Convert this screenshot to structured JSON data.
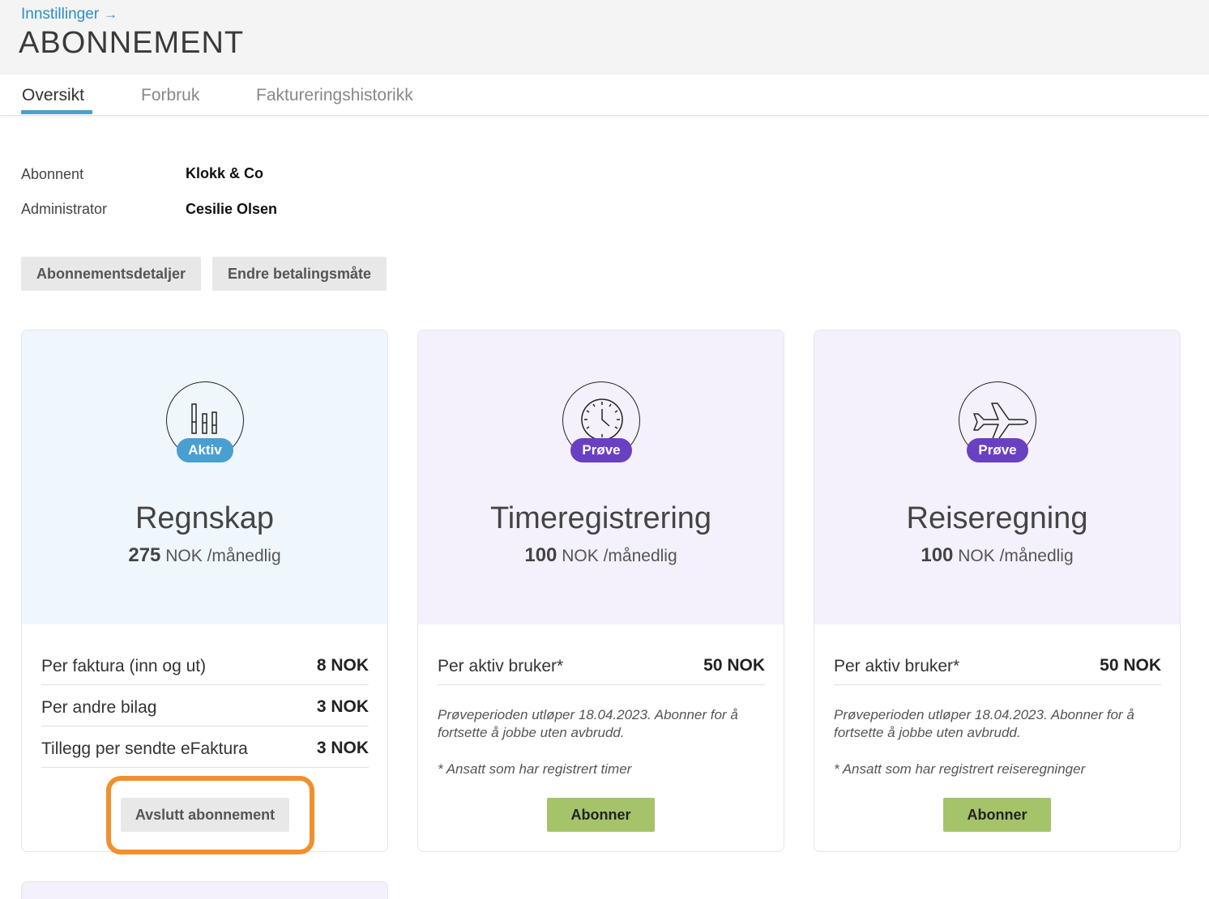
{
  "header": {
    "breadcrumb": "Innstillinger",
    "breadcrumb_arrow": "→",
    "title": "ABONNEMENT"
  },
  "tabs": [
    {
      "label": "Oversikt",
      "active": true
    },
    {
      "label": "Forbruk",
      "active": false
    },
    {
      "label": "Faktureringshistorikk",
      "active": false
    }
  ],
  "info": {
    "subscriber_label": "Abonnent",
    "subscriber_value": "Klokk & Co",
    "admin_label": "Administrator",
    "admin_value": "Cesilie Olsen"
  },
  "actions": {
    "details_label": "Abonnementsdetaljer",
    "payment_label": "Endre betalingsmåte"
  },
  "cards": [
    {
      "name": "Regnskap",
      "icon": "chart-bars-icon",
      "badge": "Aktiv",
      "price_amount": "275",
      "price_unit": "NOK /månedlig",
      "rows": [
        {
          "label": "Per faktura (inn og ut)",
          "value": "8 NOK"
        },
        {
          "label": "Per andre bilag",
          "value": "3 NOK"
        },
        {
          "label": "Tillegg per sendte eFaktura",
          "value": "3 NOK"
        }
      ],
      "button": "Avslutt abonnement"
    },
    {
      "name": "Timeregistrering",
      "icon": "clock-icon",
      "badge": "Prøve",
      "price_amount": "100",
      "price_unit": "NOK /månedlig",
      "rows": [
        {
          "label": "Per aktiv bruker*",
          "value": "50 NOK"
        }
      ],
      "note": "Prøveperioden utløper 18.04.2023. Abonner for å fortsette å jobbe uten avbrudd.",
      "footnote": "* Ansatt som har registrert timer",
      "button": "Abonner"
    },
    {
      "name": "Reiseregning",
      "icon": "airplane-icon",
      "badge": "Prøve",
      "price_amount": "100",
      "price_unit": "NOK /månedlig",
      "rows": [
        {
          "label": "Per aktiv bruker*",
          "value": "50 NOK"
        }
      ],
      "note": "Prøveperioden utløper 18.04.2023. Abonner for å fortsette å jobbe uten avbrudd.",
      "footnote": "* Ansatt som har registrert reiseregninger",
      "button": "Abonner"
    }
  ],
  "colors": {
    "link": "#2b8fc9",
    "active_badge": "#4a9fd1",
    "trial_badge": "#6a40c2",
    "subscribe_button": "#a5c46a",
    "highlight": "#f0902c"
  }
}
